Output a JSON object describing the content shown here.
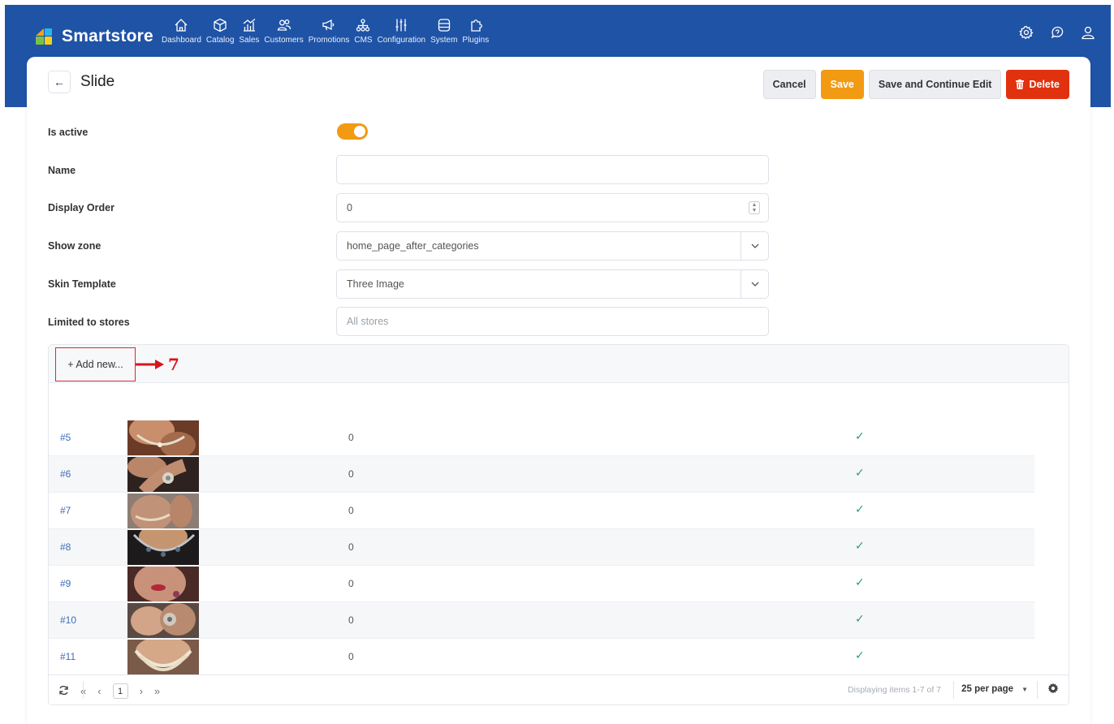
{
  "app": {
    "brand": "Smartstore"
  },
  "nav": [
    {
      "label": "Dashboard",
      "icon": "home-icon"
    },
    {
      "label": "Catalog",
      "icon": "box-icon"
    },
    {
      "label": "Sales",
      "icon": "chart-icon"
    },
    {
      "label": "Customers",
      "icon": "users-icon"
    },
    {
      "label": "Promotions",
      "icon": "megaphone-icon"
    },
    {
      "label": "CMS",
      "icon": "sitemap-icon"
    },
    {
      "label": "Configuration",
      "icon": "sliders-icon"
    },
    {
      "label": "System",
      "icon": "database-icon"
    },
    {
      "label": "Plugins",
      "icon": "puzzle-icon"
    }
  ],
  "header": {
    "title": "Slide",
    "back_icon": "←"
  },
  "toolbar": {
    "cancel_label": "Cancel",
    "save_label": "Save",
    "save_continue_label": "Save and Continue Edit",
    "delete_label": "Delete"
  },
  "form": {
    "is_active": {
      "label": "Is active",
      "value": true
    },
    "name": {
      "label": "Name",
      "value": ""
    },
    "display_order": {
      "label": "Display Order",
      "value": "0"
    },
    "show_zone": {
      "label": "Show zone",
      "value": "home_page_after_categories"
    },
    "skin_template": {
      "label": "Skin Template",
      "value": "Three Image"
    },
    "limited_to_stores": {
      "label": "Limited to stores",
      "placeholder": "All stores"
    }
  },
  "grid": {
    "add_new_label": "+ Add new...",
    "annotation": "7",
    "rows": [
      {
        "id": "#5",
        "value": "0",
        "active": "✓"
      },
      {
        "id": "#6",
        "value": "0",
        "active": "✓"
      },
      {
        "id": "#7",
        "value": "0",
        "active": "✓"
      },
      {
        "id": "#8",
        "value": "0",
        "active": "✓"
      },
      {
        "id": "#9",
        "value": "0",
        "active": "✓"
      },
      {
        "id": "#10",
        "value": "0",
        "active": "✓"
      },
      {
        "id": "#11",
        "value": "0",
        "active": "✓"
      }
    ],
    "pager": {
      "first": "«",
      "prev": "‹",
      "page": "1",
      "next": "›",
      "last": "»",
      "info": "Displaying items 1-7 of 7",
      "per_page": "25 per page"
    }
  },
  "colors": {
    "nav_bg": "#1f53a6",
    "accent": "#f29a12",
    "danger": "#e0320f",
    "link": "#3d6db8",
    "check": "#2aa06a"
  }
}
